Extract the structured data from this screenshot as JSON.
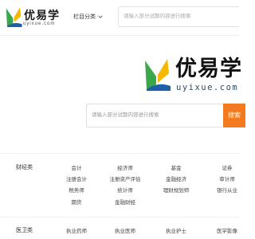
{
  "header": {
    "logo_text": "优易学",
    "logo_sub": "uyixue.com",
    "category_label": "栏目分类",
    "search_placeholder": "请输入部分试题内容进行搜索"
  },
  "hero": {
    "logo_text": "优易学",
    "logo_sub": "uyixue.com",
    "search_placeholder": "请输入部分试题内容进行搜索",
    "search_button": "搜索"
  },
  "colors": {
    "accent": "#f47a20",
    "logo_yellow": "#f5b800",
    "logo_green": "#3aa84a",
    "logo_blue": "#1f5fa8"
  },
  "categories": [
    {
      "label": "财经类",
      "rows": [
        [
          "会计",
          "经济师",
          "基金",
          "证券"
        ],
        [
          "注册会计",
          "注册资产评估",
          "金融经济",
          "审计师"
        ],
        [
          "税务师",
          "统计师",
          "理财规划师",
          "银行从业"
        ],
        [
          "期货",
          "金融财经"
        ]
      ]
    },
    {
      "label": "医卫类",
      "rows": [
        [
          "执业药师",
          "执业医师",
          "执业护士",
          "医学影像"
        ]
      ]
    }
  ]
}
